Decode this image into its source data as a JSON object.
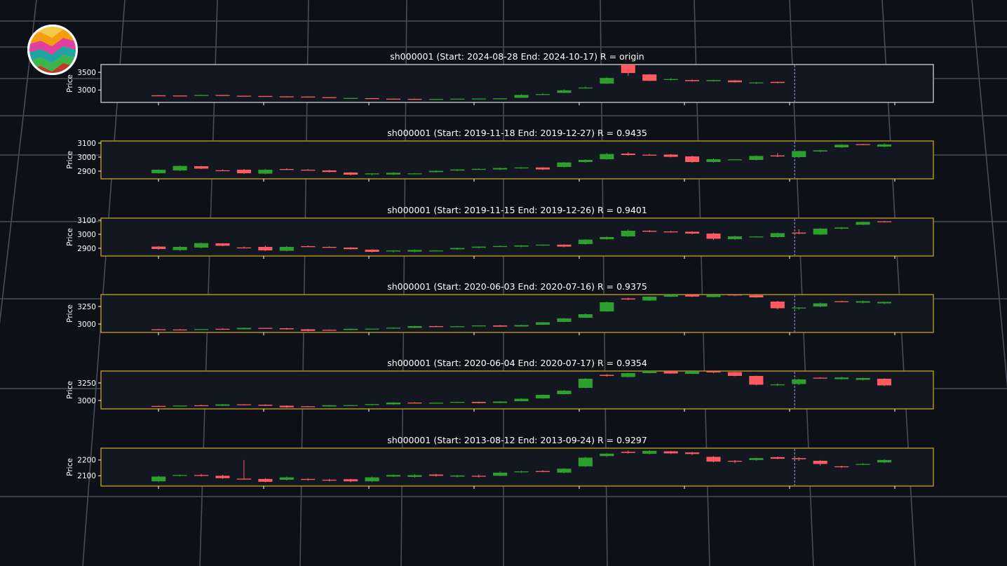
{
  "colors": {
    "up": "#2ca02c",
    "down": "#ff5a5f",
    "origin_frame": "#d0d0d0",
    "match_frame": "#c8a020",
    "split_line": "#9aa0ff"
  },
  "logo_icon": "rainbow-stripes-logo",
  "chart_data": [
    {
      "type": "candlestick",
      "title": "sh000001 (Start: 2024-08-28  End: 2024-10-17) R = origin",
      "ylabel": "Price",
      "yticks": [
        3000,
        3500
      ],
      "ylim": [
        2650,
        3720
      ],
      "ohlc": [
        [
          2850,
          2855,
          2845,
          2845
        ],
        [
          2845,
          2850,
          2838,
          2840
        ],
        [
          2840,
          2865,
          2835,
          2860
        ],
        [
          2858,
          2862,
          2835,
          2838
        ],
        [
          2838,
          2842,
          2825,
          2830
        ],
        [
          2832,
          2836,
          2815,
          2820
        ],
        [
          2820,
          2825,
          2810,
          2815
        ],
        [
          2815,
          2820,
          2792,
          2798
        ],
        [
          2798,
          2802,
          2770,
          2775
        ],
        [
          2772,
          2780,
          2762,
          2775
        ],
        [
          2770,
          2775,
          2752,
          2755
        ],
        [
          2755,
          2760,
          2745,
          2750
        ],
        [
          2750,
          2758,
          2735,
          2740
        ],
        [
          2740,
          2752,
          2735,
          2748
        ],
        [
          2748,
          2758,
          2742,
          2755
        ],
        [
          2755,
          2762,
          2748,
          2760
        ],
        [
          2760,
          2768,
          2752,
          2765
        ],
        [
          2780,
          2880,
          2775,
          2860
        ],
        [
          2880,
          2910,
          2875,
          2885
        ],
        [
          2920,
          3020,
          2915,
          2990
        ],
        [
          3060,
          3100,
          3045,
          3070
        ],
        [
          3180,
          3360,
          3170,
          3340
        ],
        [
          3720,
          3730,
          3400,
          3480
        ],
        [
          3440,
          3450,
          3250,
          3260
        ],
        [
          3300,
          3340,
          3265,
          3310
        ],
        [
          3280,
          3300,
          3240,
          3250
        ],
        [
          3250,
          3290,
          3240,
          3280
        ],
        [
          3270,
          3280,
          3210,
          3220
        ],
        [
          3190,
          3225,
          3175,
          3215
        ],
        [
          3230,
          3240,
          3185,
          3200
        ]
      ],
      "split_index": 29.8,
      "total_slots": 39
    },
    {
      "type": "candlestick",
      "title": "sh000001 (Start: 2019-11-18  End: 2019-12-27) R = 0.9435",
      "ylabel": "Price",
      "yticks": [
        2900,
        3000,
        3100
      ],
      "ylim": [
        2845,
        3115
      ],
      "ohlc": [
        [
          2885,
          2912,
          2882,
          2910
        ],
        [
          2905,
          2940,
          2900,
          2937
        ],
        [
          2935,
          2937,
          2915,
          2918
        ],
        [
          2906,
          2912,
          2900,
          2902
        ],
        [
          2910,
          2915,
          2880,
          2885
        ],
        [
          2882,
          2915,
          2878,
          2910
        ],
        [
          2915,
          2920,
          2908,
          2912
        ],
        [
          2910,
          2914,
          2905,
          2908
        ],
        [
          2905,
          2908,
          2890,
          2894
        ],
        [
          2890,
          2893,
          2870,
          2875
        ],
        [
          2877,
          2886,
          2870,
          2884
        ],
        [
          2876,
          2892,
          2872,
          2888
        ],
        [
          2882,
          2886,
          2878,
          2884
        ],
        [
          2893,
          2905,
          2890,
          2902
        ],
        [
          2904,
          2914,
          2900,
          2912
        ],
        [
          2913,
          2920,
          2910,
          2916
        ],
        [
          2912,
          2925,
          2908,
          2922
        ],
        [
          2922,
          2928,
          2918,
          2926
        ],
        [
          2926,
          2928,
          2908,
          2912
        ],
        [
          2930,
          2965,
          2925,
          2962
        ],
        [
          2965,
          2985,
          2960,
          2980
        ],
        [
          2985,
          3030,
          2980,
          3022
        ],
        [
          3025,
          3035,
          3010,
          3015
        ],
        [
          3017,
          3022,
          3010,
          3012
        ],
        [
          3018,
          3022,
          2998,
          3002
        ],
        [
          3005,
          3010,
          2960,
          2965
        ],
        [
          2965,
          2990,
          2960,
          2985
        ],
        [
          2980,
          2986,
          2978,
          2984
        ],
        [
          2980,
          3012,
          2975,
          3008
        ],
        [
          3012,
          3030,
          3000,
          3005
        ],
        [
          3000,
          3045,
          2995,
          3043
        ],
        [
          3040,
          3052,
          3035,
          3048
        ],
        [
          3070,
          3092,
          3065,
          3088
        ],
        [
          3092,
          3095,
          3085,
          3086
        ],
        [
          3075,
          3098,
          3070,
          3090
        ]
      ],
      "split_index": 29.8,
      "total_slots": 39
    },
    {
      "type": "candlestick",
      "title": "sh000001 (Start: 2019-11-15  End: 2019-12-26) R = 0.9401",
      "ylabel": "Price",
      "yticks": [
        2900,
        3000,
        3100
      ],
      "ylim": [
        2845,
        3115
      ],
      "ohlc": [
        [
          2912,
          2915,
          2890,
          2895
        ],
        [
          2887,
          2915,
          2882,
          2910
        ],
        [
          2905,
          2940,
          2900,
          2937
        ],
        [
          2935,
          2937,
          2915,
          2918
        ],
        [
          2906,
          2912,
          2900,
          2902
        ],
        [
          2910,
          2920,
          2880,
          2885
        ],
        [
          2882,
          2915,
          2878,
          2910
        ],
        [
          2915,
          2920,
          2908,
          2912
        ],
        [
          2910,
          2914,
          2905,
          2908
        ],
        [
          2905,
          2908,
          2890,
          2894
        ],
        [
          2890,
          2893,
          2870,
          2875
        ],
        [
          2877,
          2886,
          2870,
          2884
        ],
        [
          2876,
          2892,
          2872,
          2888
        ],
        [
          2882,
          2886,
          2878,
          2884
        ],
        [
          2893,
          2905,
          2890,
          2902
        ],
        [
          2904,
          2914,
          2900,
          2912
        ],
        [
          2913,
          2920,
          2910,
          2916
        ],
        [
          2912,
          2922,
          2908,
          2920
        ],
        [
          2922,
          2928,
          2918,
          2926
        ],
        [
          2926,
          2928,
          2908,
          2912
        ],
        [
          2930,
          2965,
          2925,
          2962
        ],
        [
          2965,
          2985,
          2960,
          2980
        ],
        [
          2985,
          3035,
          2980,
          3025
        ],
        [
          3025,
          3030,
          3015,
          3018
        ],
        [
          3020,
          3024,
          3012,
          3015
        ],
        [
          3018,
          3022,
          3000,
          3005
        ],
        [
          3005,
          3010,
          2960,
          2968
        ],
        [
          2965,
          2990,
          2960,
          2985
        ],
        [
          2980,
          2986,
          2978,
          2984
        ],
        [
          2980,
          3012,
          2975,
          3008
        ],
        [
          3012,
          3035,
          3000,
          3005
        ],
        [
          2998,
          3045,
          2995,
          3040
        ],
        [
          3040,
          3052,
          3035,
          3048
        ],
        [
          3068,
          3090,
          3065,
          3088
        ],
        [
          3092,
          3095,
          3085,
          3086
        ]
      ],
      "split_index": 29.8,
      "total_slots": 39
    },
    {
      "type": "candlestick",
      "title": "sh000001 (Start: 2020-06-03  End: 2020-07-16) R = 0.9375",
      "ylabel": "Price",
      "yticks": [
        3000,
        3250
      ],
      "ylim": [
        2880,
        3420
      ],
      "ohlc": [
        [
          2925,
          2930,
          2918,
          2922
        ],
        [
          2922,
          2928,
          2916,
          2920
        ],
        [
          2920,
          2930,
          2918,
          2928
        ],
        [
          2932,
          2940,
          2925,
          2930
        ],
        [
          2925,
          2950,
          2922,
          2945
        ],
        [
          2945,
          2948,
          2935,
          2938
        ],
        [
          2940,
          2944,
          2920,
          2925
        ],
        [
          2925,
          2930,
          2895,
          2902
        ],
        [
          2918,
          2922,
          2905,
          2910
        ],
        [
          2915,
          2935,
          2912,
          2932
        ],
        [
          2930,
          2936,
          2926,
          2934
        ],
        [
          2935,
          2952,
          2930,
          2948
        ],
        [
          2945,
          2975,
          2940,
          2970
        ],
        [
          2970,
          2976,
          2962,
          2965
        ],
        [
          2960,
          2972,
          2955,
          2968
        ],
        [
          2975,
          2982,
          2965,
          2980
        ],
        [
          2980,
          2985,
          2960,
          2963
        ],
        [
          2965,
          2990,
          2962,
          2985
        ],
        [
          2990,
          3030,
          2988,
          3025
        ],
        [
          3030,
          3085,
          3025,
          3080
        ],
        [
          3090,
          3150,
          3085,
          3140
        ],
        [
          3180,
          3320,
          3175,
          3310
        ],
        [
          3365,
          3375,
          3340,
          3350
        ],
        [
          3335,
          3395,
          3330,
          3390
        ],
        [
          3390,
          3425,
          3385,
          3420
        ],
        [
          3420,
          3425,
          3385,
          3392
        ],
        [
          3385,
          3420,
          3380,
          3418
        ],
        [
          3420,
          3425,
          3400,
          3410
        ],
        [
          3410,
          3415,
          3375,
          3380
        ],
        [
          3320,
          3330,
          3210,
          3225
        ],
        [
          3225,
          3240,
          3205,
          3235
        ],
        [
          3250,
          3305,
          3240,
          3295
        ],
        [
          3325,
          3332,
          3312,
          3318
        ],
        [
          3305,
          3335,
          3295,
          3325
        ],
        [
          3295,
          3320,
          3285,
          3315
        ]
      ],
      "split_index": 29.8,
      "total_slots": 39
    },
    {
      "type": "candlestick",
      "title": "sh000001 (Start: 2020-06-04  End: 2020-07-17) R = 0.9354",
      "ylabel": "Price",
      "yticks": [
        3000,
        3250
      ],
      "ylim": [
        2880,
        3420
      ],
      "ohlc": [
        [
          2922,
          2928,
          2916,
          2920
        ],
        [
          2920,
          2930,
          2918,
          2928
        ],
        [
          2932,
          2940,
          2925,
          2930
        ],
        [
          2925,
          2950,
          2922,
          2945
        ],
        [
          2945,
          2948,
          2935,
          2938
        ],
        [
          2940,
          2944,
          2920,
          2925
        ],
        [
          2925,
          2930,
          2895,
          2902
        ],
        [
          2918,
          2922,
          2905,
          2910
        ],
        [
          2915,
          2935,
          2912,
          2932
        ],
        [
          2930,
          2936,
          2926,
          2934
        ],
        [
          2935,
          2952,
          2930,
          2948
        ],
        [
          2945,
          2975,
          2940,
          2970
        ],
        [
          2970,
          2976,
          2962,
          2965
        ],
        [
          2960,
          2972,
          2955,
          2968
        ],
        [
          2975,
          2982,
          2965,
          2980
        ],
        [
          2980,
          2985,
          2960,
          2963
        ],
        [
          2965,
          2990,
          2962,
          2985
        ],
        [
          2990,
          3030,
          2988,
          3025
        ],
        [
          3030,
          3085,
          3025,
          3080
        ],
        [
          3090,
          3150,
          3085,
          3140
        ],
        [
          3180,
          3320,
          3175,
          3310
        ],
        [
          3365,
          3375,
          3340,
          3350
        ],
        [
          3335,
          3395,
          3330,
          3390
        ],
        [
          3390,
          3425,
          3385,
          3420
        ],
        [
          3420,
          3425,
          3380,
          3385
        ],
        [
          3380,
          3420,
          3375,
          3418
        ],
        [
          3420,
          3425,
          3390,
          3400
        ],
        [
          3405,
          3410,
          3345,
          3350
        ],
        [
          3350,
          3355,
          3215,
          3225
        ],
        [
          3225,
          3245,
          3205,
          3230
        ],
        [
          3235,
          3310,
          3220,
          3300
        ],
        [
          3325,
          3332,
          3312,
          3318
        ],
        [
          3305,
          3340,
          3295,
          3328
        ],
        [
          3295,
          3325,
          3285,
          3320
        ],
        [
          3310,
          3315,
          3205,
          3215
        ]
      ],
      "split_index": 29.8,
      "total_slots": 39
    },
    {
      "type": "candlestick",
      "title": "sh000001 (Start: 2013-08-12  End: 2013-09-24) R = 0.9297",
      "ylabel": "Price",
      "yticks": [
        2100,
        2200
      ],
      "ylim": [
        2035,
        2275
      ],
      "ohlc": [
        [
          2065,
          2100,
          2060,
          2095
        ],
        [
          2100,
          2108,
          2096,
          2105
        ],
        [
          2105,
          2112,
          2095,
          2100
        ],
        [
          2100,
          2106,
          2080,
          2085
        ],
        [
          2082,
          2200,
          2075,
          2080
        ],
        [
          2080,
          2086,
          2058,
          2062
        ],
        [
          2075,
          2095,
          2070,
          2090
        ],
        [
          2080,
          2085,
          2068,
          2075
        ],
        [
          2075,
          2080,
          2065,
          2072
        ],
        [
          2078,
          2082,
          2060,
          2065
        ],
        [
          2065,
          2095,
          2060,
          2090
        ],
        [
          2095,
          2108,
          2092,
          2105
        ],
        [
          2093,
          2110,
          2088,
          2104
        ],
        [
          2108,
          2112,
          2095,
          2100
        ],
        [
          2095,
          2105,
          2090,
          2102
        ],
        [
          2100,
          2108,
          2090,
          2095
        ],
        [
          2100,
          2128,
          2098,
          2120
        ],
        [
          2122,
          2132,
          2118,
          2128
        ],
        [
          2130,
          2135,
          2122,
          2125
        ],
        [
          2120,
          2148,
          2115,
          2145
        ],
        [
          2160,
          2220,
          2155,
          2215
        ],
        [
          2225,
          2245,
          2220,
          2240
        ],
        [
          2252,
          2260,
          2240,
          2245
        ],
        [
          2240,
          2262,
          2235,
          2258
        ],
        [
          2255,
          2258,
          2238,
          2242
        ],
        [
          2248,
          2252,
          2232,
          2238
        ],
        [
          2220,
          2225,
          2185,
          2190
        ],
        [
          2195,
          2200,
          2180,
          2190
        ],
        [
          2200,
          2215,
          2195,
          2212
        ],
        [
          2218,
          2222,
          2205,
          2208
        ],
        [
          2212,
          2218,
          2195,
          2205
        ],
        [
          2195,
          2200,
          2165,
          2175
        ],
        [
          2160,
          2165,
          2150,
          2158
        ],
        [
          2172,
          2180,
          2168,
          2175
        ],
        [
          2185,
          2205,
          2180,
          2200
        ]
      ],
      "split_index": 29.8,
      "total_slots": 39
    }
  ]
}
